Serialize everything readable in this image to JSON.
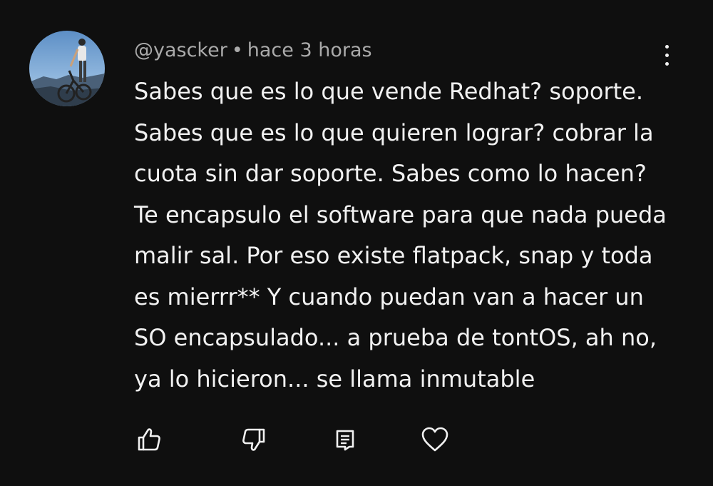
{
  "comment": {
    "author": "@yascker",
    "separator": "•",
    "timestamp": "hace 3 horas",
    "text_lines": [
      "Sabes que es lo que vende Redhat? soporte.",
      "Sabes que es lo que quieren lograr? cobrar la",
      "cuota sin dar soporte. Sabes como lo hacen?",
      "Te encapsulo el software para que nada pueda",
      "malir sal. Por eso existe flatpack, snap y toda",
      "es mierrr** Y cuando puedan van a hacer un",
      "SO encapsulado... a prueba de tontOS, ah no,",
      "ya lo hicieron... se llama inmutable"
    ]
  },
  "menu": {
    "icon": "more-vert-icon"
  },
  "actions": [
    {
      "name": "like",
      "icon": "thumb-up-icon"
    },
    {
      "name": "dislike",
      "icon": "thumb-down-icon"
    },
    {
      "name": "reply",
      "icon": "comment-icon"
    },
    {
      "name": "heart",
      "icon": "heart-icon"
    }
  ],
  "colors": {
    "background": "#0f0f0f",
    "text_primary": "#f1f1f1",
    "text_secondary": "#aaaaaa"
  }
}
